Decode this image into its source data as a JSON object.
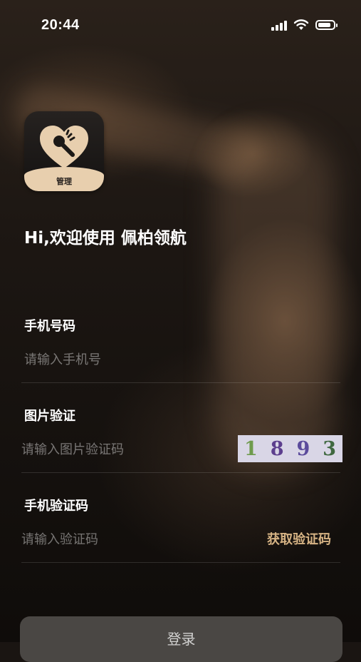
{
  "status_bar": {
    "time": "20:44"
  },
  "app": {
    "icon_badge": "管理"
  },
  "welcome": "Hi,欢迎使用 佩柏领航",
  "form": {
    "phone": {
      "label": "手机号码",
      "placeholder": "请输入手机号"
    },
    "image_code": {
      "label": "图片验证",
      "placeholder": "请输入图片验证码",
      "captcha": [
        "1",
        "8",
        "9",
        "3"
      ]
    },
    "sms_code": {
      "label": "手机验证码",
      "placeholder": "请输入验证码",
      "get_code": "获取验证码"
    }
  },
  "login_label": "登录",
  "colors": {
    "accent": "#d6b384",
    "icon_bottom": "#e8cfae",
    "button_bg": "#4a4744"
  },
  "icons": [
    "signal-icon",
    "wifi-icon",
    "battery-icon",
    "heart-microphone-icon"
  ]
}
